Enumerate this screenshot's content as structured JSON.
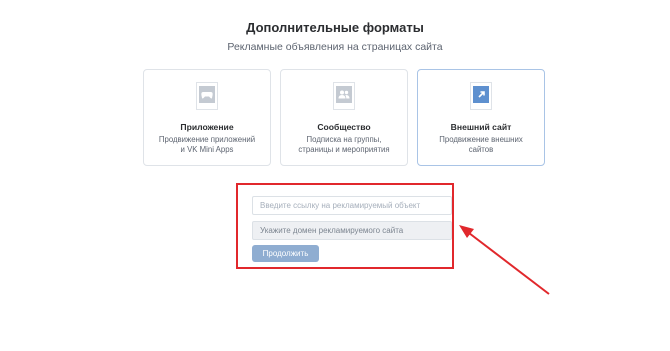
{
  "header": {
    "title": "Дополнительные форматы",
    "subtitle": "Рекламные объявления на страницах сайта"
  },
  "cards": [
    {
      "title": "Приложение",
      "desc_line1": "Продвижение приложений",
      "desc_line2": "и VK Mini Apps",
      "icon": "gamepad-icon",
      "selected": false
    },
    {
      "title": "Сообщество",
      "desc_line1": "Подписка на группы,",
      "desc_line2": "страницы и мероприятия",
      "icon": "users-icon",
      "selected": false
    },
    {
      "title": "Внешний сайт",
      "desc_line1": "Продвижение внешних",
      "desc_line2": "сайтов",
      "icon": "external-link-icon",
      "selected": true
    }
  ],
  "form": {
    "link_placeholder": "Введите ссылку на рекламируемый объект",
    "link_value": "",
    "domain_placeholder": "Укажите домен рекламируемого сайта",
    "domain_value": "",
    "continue_label": "Продолжить"
  },
  "colors": {
    "accent": "#5e90cf",
    "button": "#8fadd1",
    "annotation_red": "#e1282c"
  }
}
